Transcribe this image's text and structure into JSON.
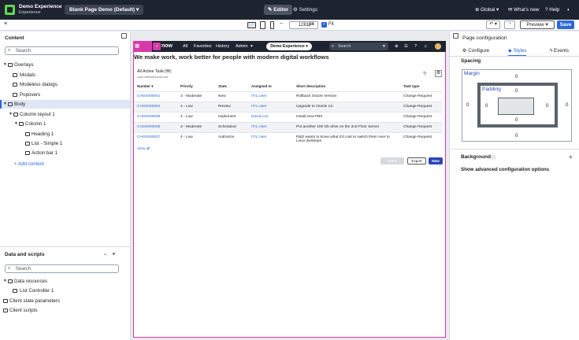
{
  "header": {
    "app_title": "Demo Experience",
    "app_subtitle": "Experience",
    "page_selector": "Blank Page Demo (Default)",
    "editor_label": "Editor",
    "settings_label": "Settings",
    "global_label": "Global",
    "whats_new_label": "What's new",
    "help_label": "Help"
  },
  "toolbar": {
    "width_value": "1281",
    "width_unit": "px",
    "fit_label": "Fit",
    "preview_label": "Preview",
    "save_label": "Save"
  },
  "content_panel": {
    "heading": "Content",
    "search_placeholder": "Search",
    "tree": [
      {
        "label": "Overlays"
      },
      {
        "label": "Modals"
      },
      {
        "label": "Modeless dialogs"
      },
      {
        "label": "Popovers"
      },
      {
        "label": "Body"
      },
      {
        "label": "Column layout 1"
      },
      {
        "label": "Column 1"
      },
      {
        "label": "Heading 1"
      },
      {
        "label": "List - Simple 1"
      },
      {
        "label": "Action bar 1"
      }
    ],
    "add_content": "+ Add content"
  },
  "data_panel": {
    "heading": "Data and scripts",
    "search_placeholder": "Search",
    "tree": [
      {
        "label": "Data resources"
      },
      {
        "label": "List Controller 1"
      },
      {
        "label": "Client state parameters"
      },
      {
        "label": "Client scripts"
      }
    ]
  },
  "canvas": {
    "body_tag": "Body",
    "brand": "now",
    "nav": [
      "All",
      "Favorites",
      "History",
      "Admin"
    ],
    "scope": "Demo Experience",
    "search_placeholder": "Search",
    "headline": "We make work, work better for people with modern digital workflows",
    "list": {
      "title": "All Active Tasks",
      "badge": "782",
      "subtitle": "Last refreshed just now",
      "columns": [
        "Number",
        "Priority",
        "State",
        "Assigned to",
        "Short description",
        "Task type"
      ],
      "rows": [
        {
          "number": "CHG0000001",
          "priority": "3 - Moderate",
          "state": "New",
          "assigned": "ITIL User",
          "desc": "Rollback Oracle Version",
          "type": "Change Request"
        },
        {
          "number": "CHG0000004",
          "priority": "4 - Low",
          "state": "Review",
          "assigned": "ITIL User",
          "desc": "Upgrade to Oracle 11i",
          "type": "Change Request"
        },
        {
          "number": "CHG0000005",
          "priority": "4 - Low",
          "state": "Implement",
          "assigned": "David Loo",
          "desc": "Install new PBX",
          "type": "Change Request"
        },
        {
          "number": "CHG0000006",
          "priority": "3 - Moderate",
          "state": "Scheduled",
          "assigned": "ITIL User",
          "desc": "Put another 100 Gb drive on the 2nd Floor Server",
          "type": "Change Request"
        },
        {
          "number": "CHG0000007",
          "priority": "4 - Low",
          "state": "Authorize",
          "assigned": "ITIL User",
          "desc": "R&D wants to know what it'd cost to switch them over to Linux desktops",
          "type": "Change Request"
        }
      ],
      "view_all": "View all",
      "edit_label": "Edit",
      "export_label": "Export",
      "new_label": "New"
    }
  },
  "config_panel": {
    "title": "Page configuration",
    "tabs": [
      "Configure",
      "Styles",
      "Events"
    ],
    "spacing_label": "Spacing",
    "margin_label": "Margin",
    "padding_label": "Padding",
    "margin": {
      "top": "0",
      "right": "0",
      "bottom": "0",
      "left": "0"
    },
    "padding": {
      "top": "0",
      "right": "0",
      "bottom": "0",
      "left": "0"
    },
    "background_label": "Background",
    "advanced_label": "Show advanced configuration options"
  }
}
